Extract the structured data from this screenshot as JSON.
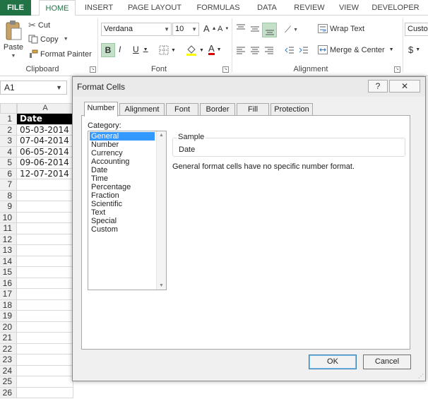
{
  "ribbon_tabs": [
    "FILE",
    "HOME",
    "INSERT",
    "PAGE LAYOUT",
    "FORMULAS",
    "DATA",
    "REVIEW",
    "VIEW",
    "DEVELOPER"
  ],
  "clipboard": {
    "paste_label": "Paste",
    "cut_label": "Cut",
    "copy_label": "Copy",
    "format_painter_label": "Format Painter",
    "group_label": "Clipboard"
  },
  "font": {
    "name": "Verdana",
    "size": "10",
    "group_label": "Font",
    "grow_icon": "A",
    "shrink_icon": "A",
    "bold_label": "B",
    "italic_label": "I",
    "underline_label": "U",
    "font_color_label": "A"
  },
  "alignment": {
    "wrap_text_label": "Wrap Text",
    "merge_center_label": "Merge & Center",
    "group_label": "Alignment"
  },
  "number": {
    "format_label": "Custo",
    "currency_symbol": "$"
  },
  "sheet": {
    "name_box": "A1",
    "column_a": "A",
    "row_numbers": [
      "1",
      "2",
      "3",
      "4",
      "5",
      "6",
      "7",
      "8",
      "9",
      "10",
      "11",
      "12",
      "13",
      "14",
      "15",
      "16",
      "17",
      "18",
      "19",
      "20",
      "21",
      "22",
      "23",
      "24",
      "25",
      "26"
    ],
    "header": "Date",
    "dates": [
      "05-03-2014",
      "07-04-2014",
      "06-05-2014",
      "09-06-2014",
      "12-07-2014"
    ]
  },
  "dialog": {
    "title": "Format Cells",
    "help_label": "?",
    "close_label": "✕",
    "tabs": [
      "Number",
      "Alignment",
      "Font",
      "Border",
      "Fill",
      "Protection"
    ],
    "category_label": "Category:",
    "categories": [
      "General",
      "Number",
      "Currency",
      "Accounting",
      "Date",
      "Time",
      "Percentage",
      "Fraction",
      "Scientific",
      "Text",
      "Special",
      "Custom"
    ],
    "selected_category": "General",
    "sample_label": "Sample",
    "sample_value": "Date",
    "description": "General format cells have no specific number format.",
    "ok_label": "OK",
    "cancel_label": "Cancel"
  },
  "colors": {
    "excel_green": "#217346",
    "selection_blue": "#3399ff"
  }
}
